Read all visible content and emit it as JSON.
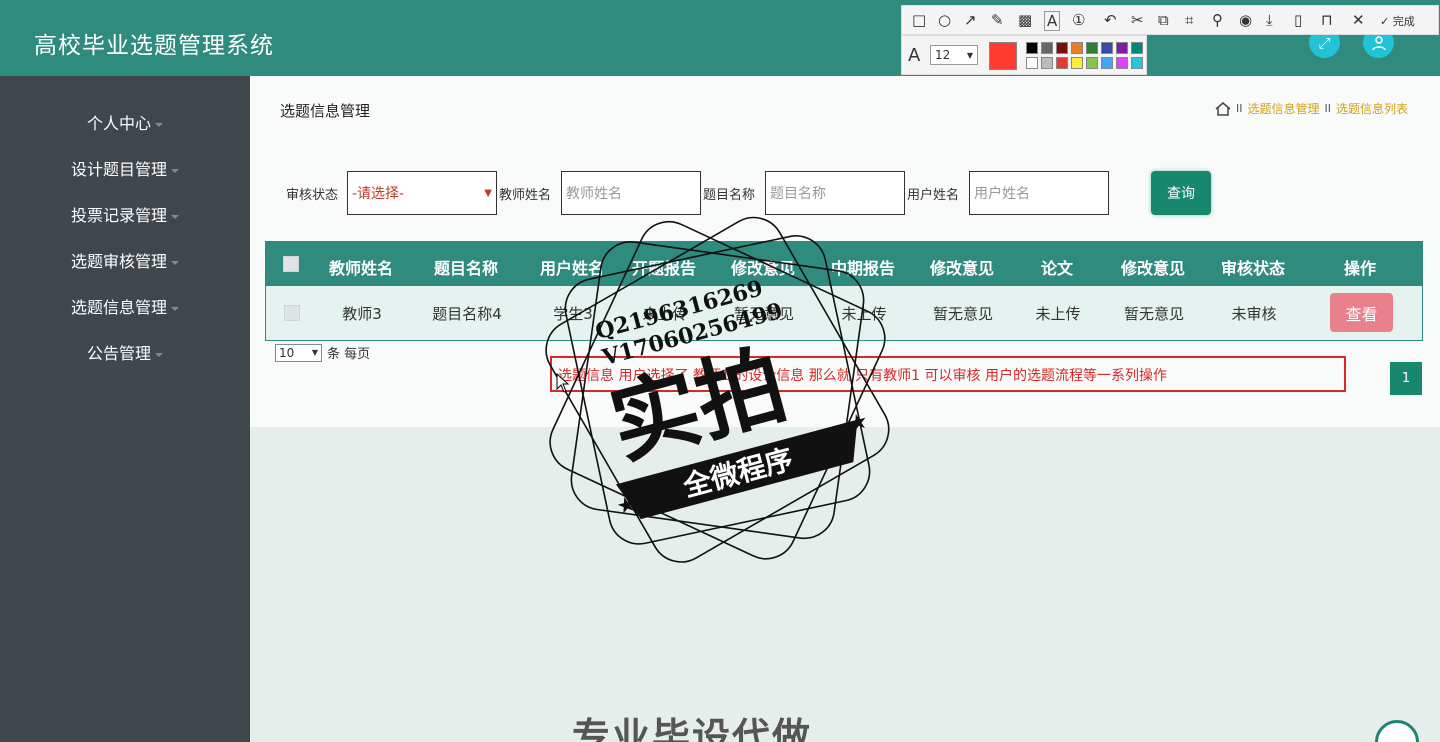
{
  "app": {
    "title": "高校毕业选题管理系统"
  },
  "sidebar": {
    "items": [
      {
        "label": "个人中心"
      },
      {
        "label": "设计题目管理"
      },
      {
        "label": "投票记录管理"
      },
      {
        "label": "选题审核管理"
      },
      {
        "label": "选题信息管理"
      },
      {
        "label": "公告管理"
      }
    ]
  },
  "page": {
    "title": "选题信息管理"
  },
  "breadcrumb": {
    "items": [
      "选题信息管理",
      "选题信息列表"
    ],
    "separator": "II"
  },
  "filters": {
    "status_label": "审核状态",
    "status_selected": "-请选择-",
    "teacher_label": "教师姓名",
    "teacher_placeholder": "教师姓名",
    "topic_label": "题目名称",
    "topic_placeholder": "题目名称",
    "user_label": "用户姓名",
    "user_placeholder": "用户姓名",
    "query_button": "查询"
  },
  "table": {
    "headers": [
      "教师姓名",
      "题目名称",
      "用户姓名",
      "开题报告",
      "修改意见",
      "中期报告",
      "修改意见",
      "论文",
      "修改意见",
      "审核状态",
      "操作"
    ],
    "rows": [
      {
        "cells": [
          "教师3",
          "题目名称4",
          "学生3",
          "未上传",
          "暂无意见",
          "未上传",
          "暂无意见",
          "未上传",
          "暂无意见",
          "未审核"
        ],
        "action": "查看"
      }
    ]
  },
  "pagination": {
    "page_size": "10",
    "suffix": "条 每页",
    "current_page": "1"
  },
  "annotation": {
    "text": "选题信息 用户选择了 教师1 的设计信息 那么就 只有教师1 可以审核 用户的选题流程等一系列操作"
  },
  "annotation_toolbar": {
    "done_label": "完成",
    "font_size": "12",
    "current_color": "#ff3b30",
    "palette": [
      "#000000",
      "#666666",
      "#7a0d0d",
      "#e67e22",
      "#2e7d32",
      "#3949ab",
      "#7b1fa2",
      "#00897b",
      "#ffffff",
      "#bbbbbb",
      "#e53935",
      "#ffeb3b",
      "#8bc34a",
      "#42a5f5",
      "#e040fb",
      "#26c6da"
    ]
  },
  "watermark": {
    "line1": "Q2196316269",
    "line2": "V17060256499",
    "main": "实拍",
    "banner": "全微程序"
  },
  "background_text": "专业毕设代做",
  "colors": {
    "header": "#2e8b7e",
    "sidebar": "#3f474d",
    "accent": "#17886e",
    "view_button": "#e9818c",
    "breadcrumb": "#d4a017"
  }
}
